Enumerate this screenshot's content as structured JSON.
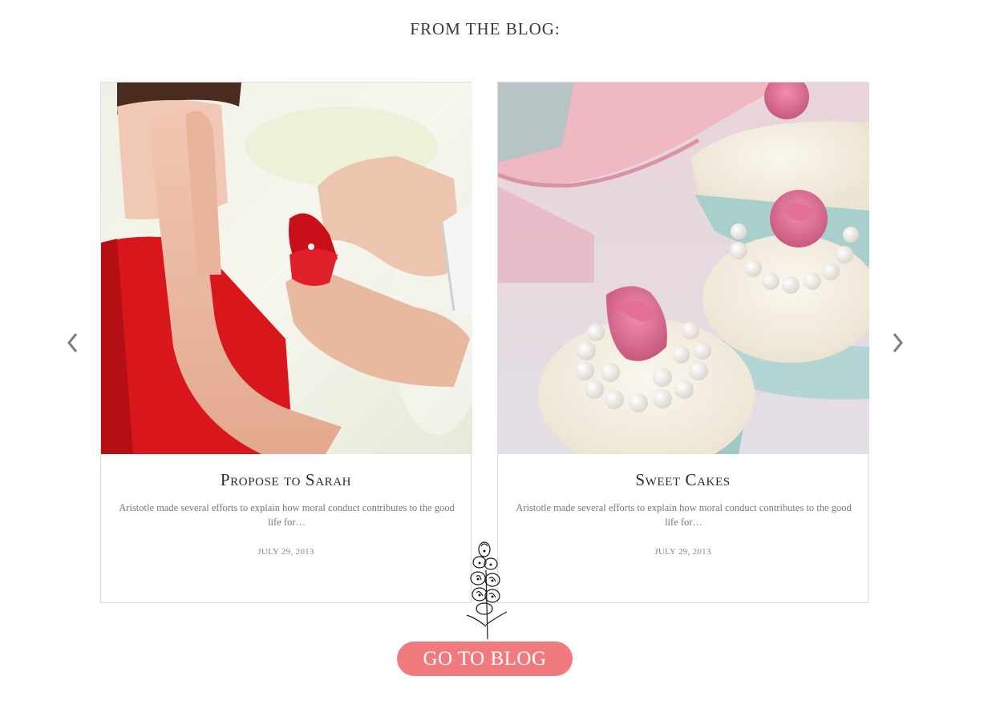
{
  "section": {
    "title": "FROM THE BLOG:"
  },
  "carousel": {
    "prev_icon": "chevron-left-icon",
    "next_icon": "chevron-right-icon"
  },
  "posts": [
    {
      "title": "Propose to Sarah",
      "excerpt": "Aristotle made several efforts to explain how moral conduct contributes to the good life for…",
      "date": "JULY 29, 2013",
      "image": "ring-proposal-photo"
    },
    {
      "title": "Sweet Cakes",
      "excerpt": "Aristotle made several efforts to explain how moral conduct contributes to the good life for…",
      "date": "JULY 29, 2013",
      "image": "rose-cupcakes-photo"
    }
  ],
  "cta": {
    "label": "GO TO BLOG"
  },
  "colors": {
    "accent": "#f07a7e",
    "text": "#2a2a2a",
    "muted": "#777777",
    "border": "#dcdcdc"
  }
}
